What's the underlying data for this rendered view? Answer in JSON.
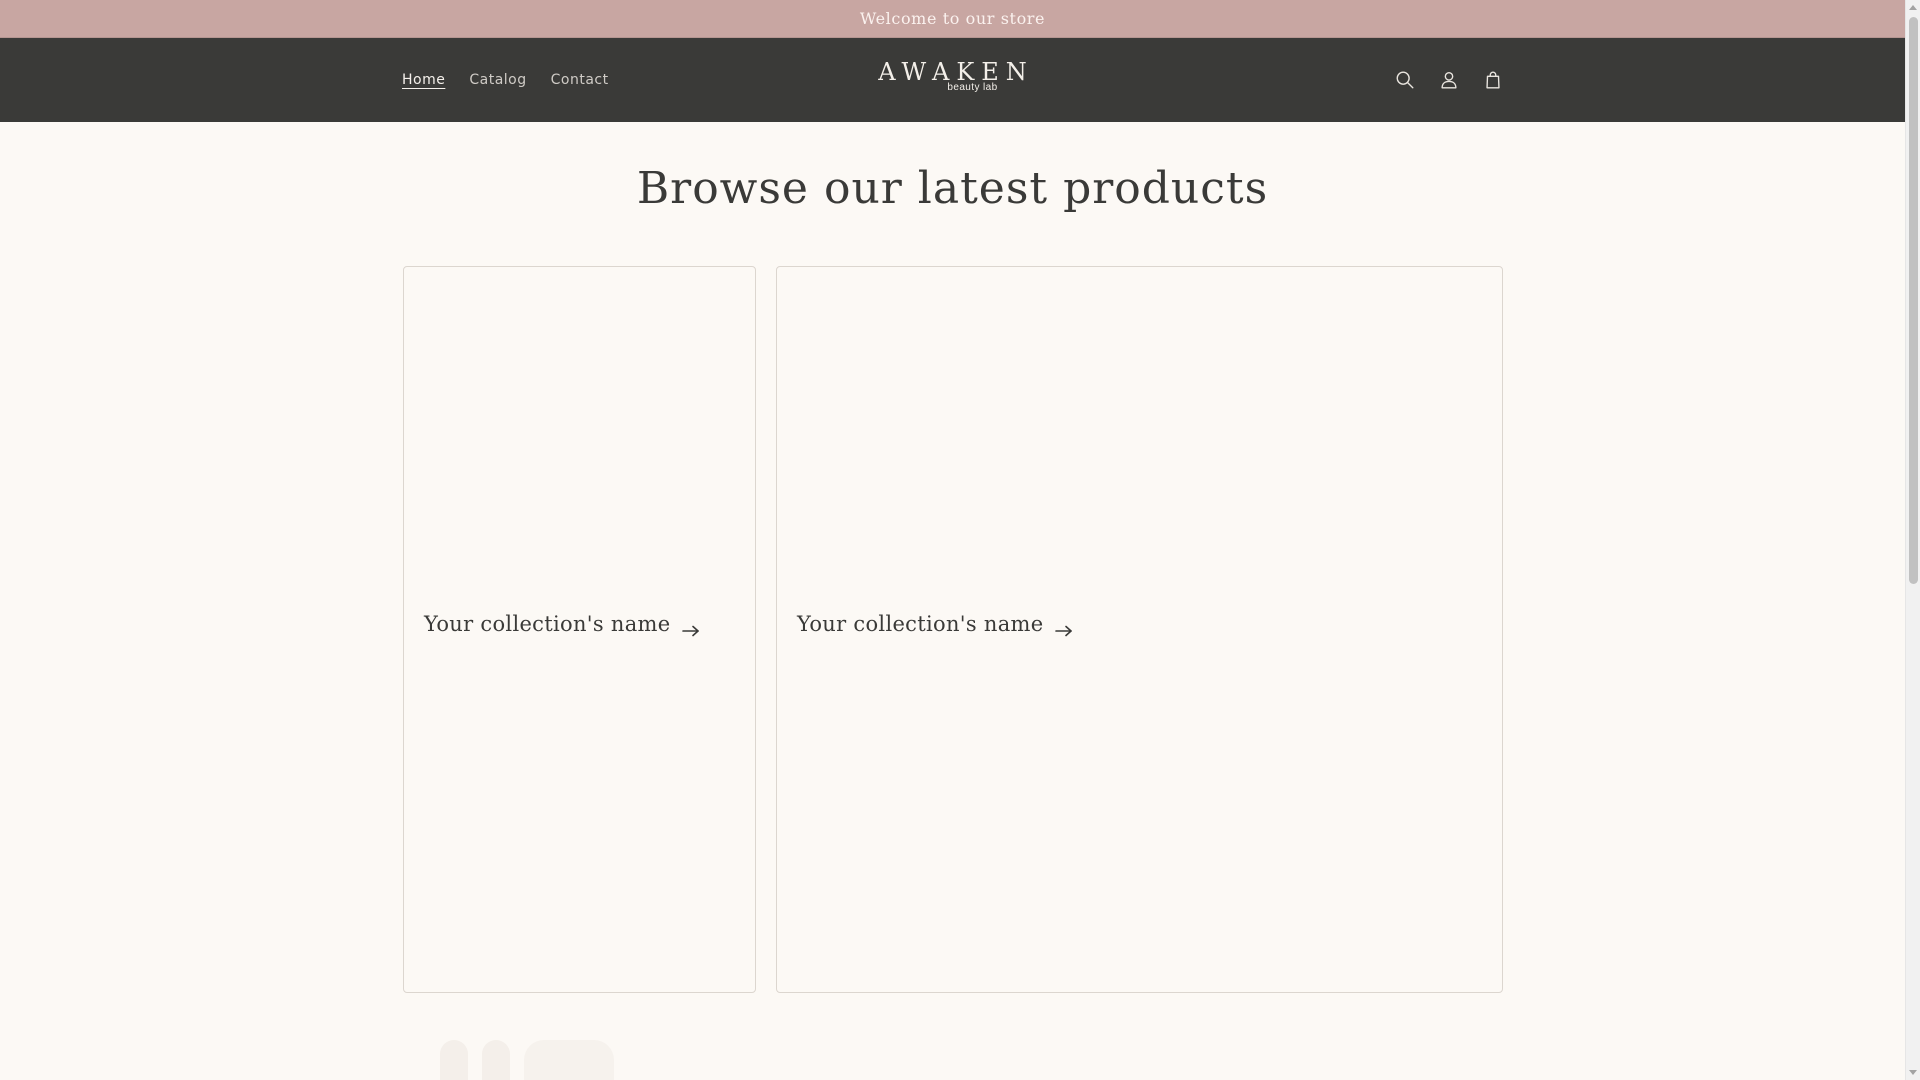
{
  "announcement": {
    "text": "Welcome to our store"
  },
  "header": {
    "nav": [
      {
        "label": "Home",
        "active": true
      },
      {
        "label": "Catalog",
        "active": false
      },
      {
        "label": "Contact",
        "active": false
      }
    ],
    "logo": {
      "main": "AWAKEN",
      "sub": "beauty lab"
    },
    "icons": [
      "search-icon",
      "account-icon",
      "cart-icon"
    ]
  },
  "main": {
    "title": "Browse our latest products",
    "collections": [
      {
        "title": "Your collection's name"
      },
      {
        "title": "Your collection's name"
      }
    ]
  },
  "colors": {
    "announcement_bg": "#c8a6a2",
    "header_bg": "#3a3a38",
    "page_bg": "#fcf9f5",
    "text_dark": "#3a3a38"
  }
}
